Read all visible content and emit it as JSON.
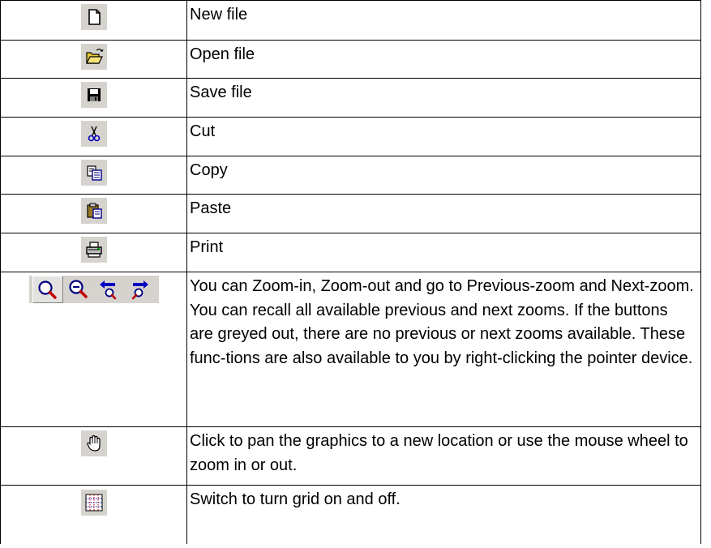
{
  "rows": [
    {
      "icon": "new-file-icon",
      "text": "New file"
    },
    {
      "icon": "open-file-icon",
      "text": "Open file"
    },
    {
      "icon": "save-file-icon",
      "text": "Save file"
    },
    {
      "icon": "cut-icon",
      "text": "Cut"
    },
    {
      "icon": "copy-icon",
      "text": "Copy"
    },
    {
      "icon": "paste-icon",
      "text": "Paste"
    },
    {
      "icon": "print-icon",
      "text": "Print"
    },
    {
      "icons": [
        "zoom-in-icon",
        "zoom-out-icon",
        "previous-zoom-icon",
        "next-zoom-icon"
      ],
      "text": "You can Zoom-in, Zoom-out and go to Previous-zoom and Next-zoom. You can recall all available previous and next zooms. If the buttons are greyed out, there are no previous or next zooms available. These func-tions are also available to you by right-clicking the pointer device."
    },
    {
      "icon": "pan-hand-icon",
      "text": "Click to pan the graphics to a new location or use the mouse wheel to zoom in or out."
    },
    {
      "icon": "grid-icon",
      "text": "Switch to turn grid on and off."
    }
  ]
}
